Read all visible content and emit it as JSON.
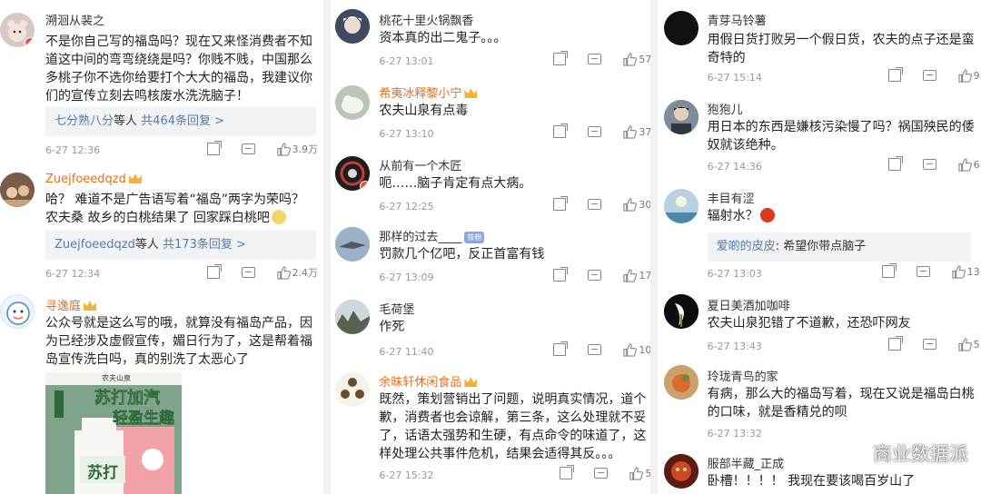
{
  "watermark": {
    "text": "商业数据派",
    "icon": "wechat-icon"
  },
  "col1": [
    {
      "user": "溯洄从裴之",
      "vip": false,
      "text_lines": [
        "不是你自己写的福岛吗？现在又来怪消费者不知",
        "道这中间的弯弯绕绕是吗？你贱不贱，中国那么",
        "多桃子你不选你给要打个大大的福岛，我建议你",
        "们的宣传立刻去鸣核废水洗洗脑子！"
      ],
      "reply_user": "七分熟八分",
      "reply_mid": "等人",
      "reply_count": "共464条回复 >",
      "time": "6-27 12:36",
      "likes": "3.9万"
    },
    {
      "user": "Zuejfoeedqzd",
      "vip": true,
      "text_lines": [
        "哈？ 难道不是广告语写着“福岛”两字为荣吗？",
        "农夫桑 故乡的白桃结果了 回家踩白桃吧"
      ],
      "reply_user": "Zuejfoeedqzd",
      "reply_mid": "等人",
      "reply_count": "共173条回复 >",
      "time": "6-27 12:34",
      "likes": "2.4万"
    },
    {
      "user": "寻逸庭",
      "vip": true,
      "text_lines": [
        "公众号就是这么写的哦，就算没有福岛产品，因",
        "为已经涉及虚假宣传，媚日行为了，这是帮着福",
        "岛宣传洗白吗，真的别洗了太恶心了"
      ],
      "image": {
        "brand": "农夫山泉",
        "tag": "苏打加汽",
        "sub": "轻盈生趣",
        "bottle": "苏打"
      }
    }
  ],
  "col2": [
    {
      "user": "桃花十里火锅飘香",
      "vip": false,
      "text": "资本真的出二鬼子。。。",
      "time": "6-27 13:01",
      "likes": "57"
    },
    {
      "user": "希夷冰释黎小宁",
      "vip": true,
      "text": "农夫山泉有点毒",
      "time": "6-27 13:10",
      "likes": "37"
    },
    {
      "user": "从前有一个木匠",
      "vip": false,
      "text": "呃……脑子肯定有点大病。",
      "time": "6-27 12:25",
      "likes": "30"
    },
    {
      "user": "那样的过去____",
      "vip": false,
      "badge": "铁粉",
      "text": "罚款几个亿吧，反正首富有钱",
      "time": "6-27 13:09",
      "likes": "17"
    },
    {
      "user": "毛荷堡",
      "vip": false,
      "text": "作死",
      "time": "6-27 11:40",
      "likes": "10"
    },
    {
      "user": "余昧轩休闲食品",
      "vip": true,
      "text_lines": [
        "既然，策划营销出了问题，说明真实情况，道个",
        "歉，消费者也会谅解，第三条，这么处理就不妥",
        "了，话语太强势和生硬，有点命令的味道了，这",
        "样处理公共事件危机，结果会适得其反。。。"
      ],
      "time": "6-27 15:32",
      "likes": "5"
    }
  ],
  "col3": [
    {
      "user": "青芽马铃薯",
      "vip": false,
      "text_lines": [
        "用假日货打败另一个假日货，农夫的点子还是蛮",
        "奇特的"
      ],
      "time": "6-27 15:14",
      "likes": "9"
    },
    {
      "user": "狍狍儿",
      "vip": false,
      "text_lines": [
        "用日本的东西是嫌核污染慢了吗？祸国殃民的倭",
        "奴就该绝种。"
      ],
      "time": "6-27 14:36",
      "likes": "6"
    },
    {
      "user": "丰目有涩",
      "vip": false,
      "text": "辐射水？",
      "reply_user": "爱啲的皮皮",
      "reply_text": ": 希望你带点脑子",
      "time": "6-27 13:03",
      "likes": "13"
    },
    {
      "user": "夏日美酒加咖啡",
      "vip": false,
      "text": "农夫山泉犯错了不道歉，还恐吓网友",
      "time": "6-27 13:43",
      "likes": "5"
    },
    {
      "user": "玲珑青鸟的家",
      "vip": false,
      "text_lines": [
        "有病，那么大的福岛写着，现在又说是福岛白桃",
        "的口味，就是香精兑的呗"
      ],
      "time": "6-27 13:32",
      "likes": ""
    },
    {
      "user": "服部半藏_正成",
      "vip": false,
      "text": "卧槽！！！！ 我现在要该喝百岁山了"
    }
  ]
}
